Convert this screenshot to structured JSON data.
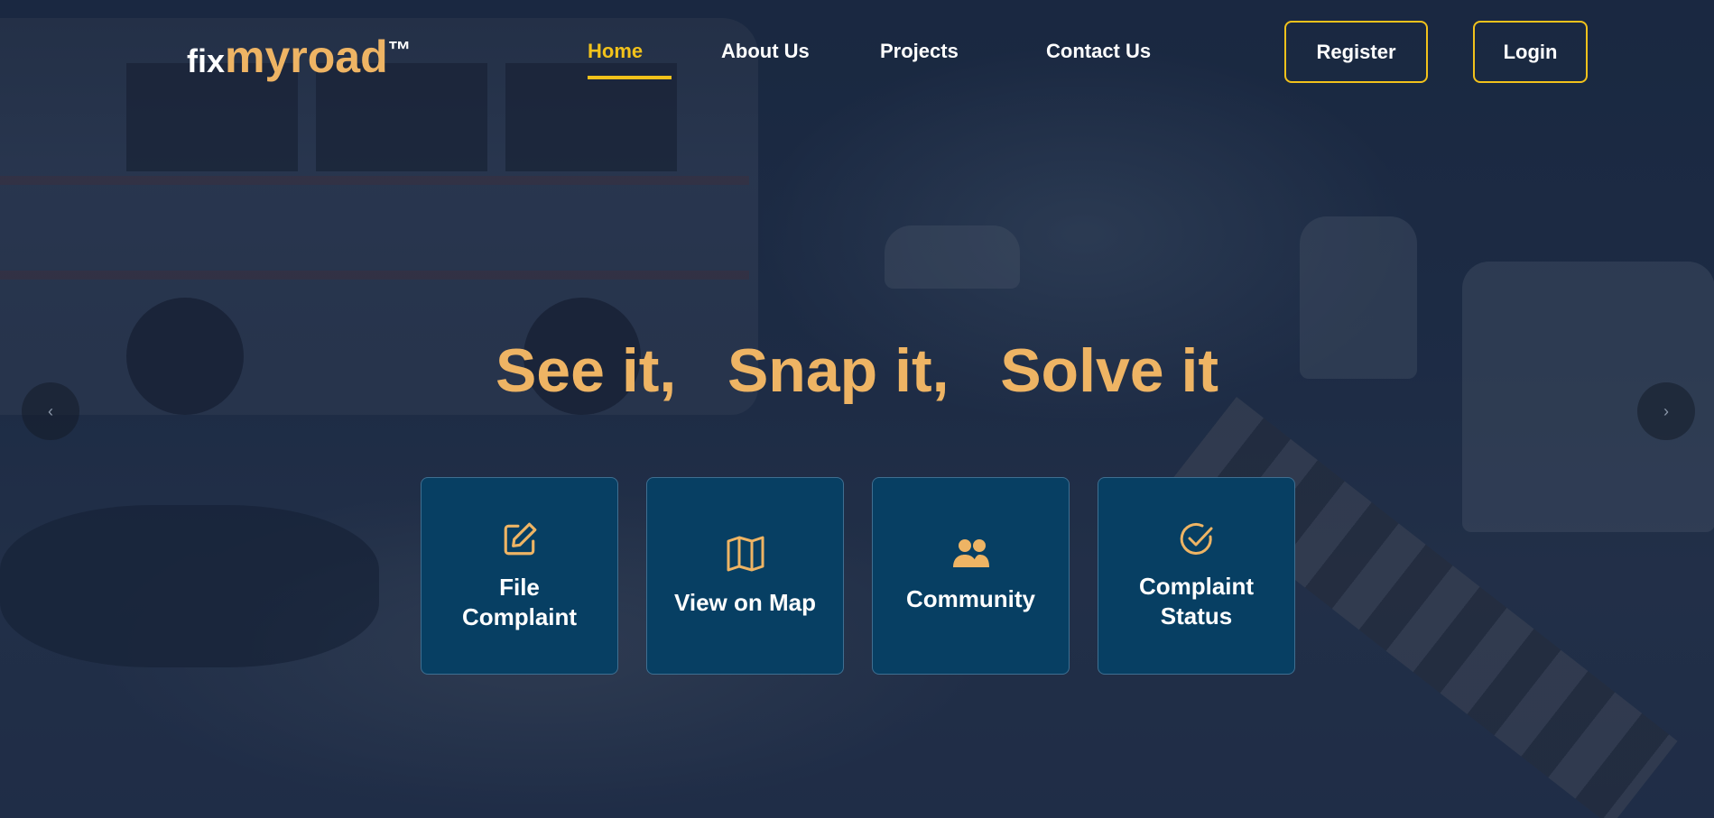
{
  "brand": {
    "part1": "fix",
    "part2": "myroad",
    "tm": "™"
  },
  "nav": {
    "links": [
      {
        "label": "Home",
        "active": true
      },
      {
        "label": "About Us",
        "active": false
      },
      {
        "label": "Projects",
        "active": false
      },
      {
        "label": "Contact Us",
        "active": false
      }
    ],
    "register_label": "Register",
    "login_label": "Login"
  },
  "hero": {
    "headline": "See it,   Snap it,   Solve it",
    "prev_arrow": "‹",
    "next_arrow": "›"
  },
  "cards": [
    {
      "label_line1": "File",
      "label_line2": "Complaint",
      "icon": "edit-icon"
    },
    {
      "label_line1": "View on Map",
      "label_line2": "",
      "icon": "map-icon"
    },
    {
      "label_line1": "Community",
      "label_line2": "",
      "icon": "users-icon"
    },
    {
      "label_line1": "Complaint",
      "label_line2": "Status",
      "icon": "check-circle-icon"
    }
  ],
  "colors": {
    "accent_gold": "#f2c21b",
    "headline_orange": "#eeb464",
    "card_bg": "#073f63"
  }
}
